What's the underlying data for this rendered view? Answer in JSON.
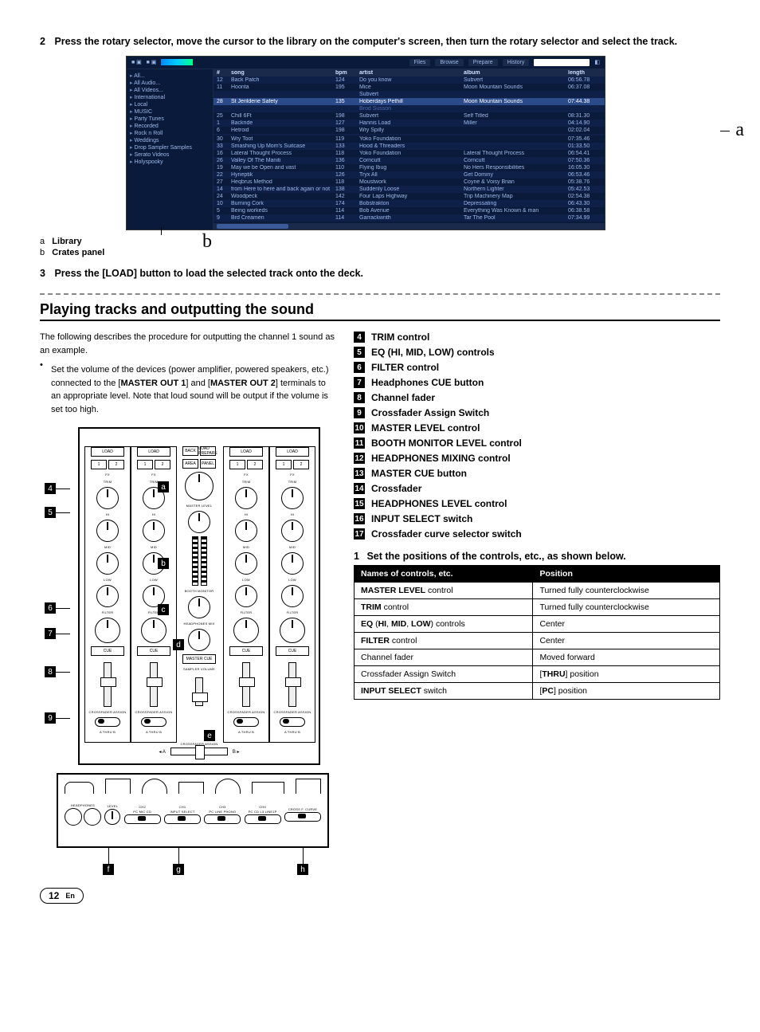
{
  "step2": {
    "num": "2",
    "text": "Press the rotary selector, move the cursor to the library on the computer's screen, then turn the rotary selector and select the track."
  },
  "shot": {
    "tabs": [
      "Files",
      "Browse",
      "Prepare",
      "History"
    ],
    "search_placeholder": "Q▾",
    "crates": [
      "All...",
      "All Audio...",
      "All Videos...",
      "International",
      "Local",
      "MUSIC",
      "Party Tunes",
      "Recorded",
      "Rock n Roll",
      "Weddings",
      "Drop Sampler Samples",
      "Serato Videos",
      "Holyspooky"
    ],
    "header": [
      "#",
      "song",
      "bpm",
      "artist",
      "album",
      "length"
    ],
    "rows": [
      {
        "n": "12",
        "song": "Back Patch",
        "bpm": "124",
        "artist": "Do you know",
        "album": "Subvert",
        "len": "06:56.78"
      },
      {
        "n": "11",
        "song": "Hoonta",
        "bpm": "195",
        "artist": "Mice",
        "album": "Moon Mountain Sounds",
        "len": "06:37.08"
      },
      {
        "n": "",
        "song": "",
        "bpm": "",
        "artist": "Subvert",
        "album": "",
        "len": ""
      },
      {
        "n": "28",
        "song": "St Jerilderie Safety",
        "bpm": "135",
        "artist": "Hoberdays Pethill",
        "album": "Moon Mountain Sounds",
        "len": "07:44.38",
        "hl": true
      },
      {
        "n": "",
        "song": "",
        "bpm": "",
        "artist": "Brod Susson",
        "album": "",
        "len": "",
        "dim": true
      },
      {
        "n": "25",
        "song": "Chill 6Ft",
        "bpm": "198",
        "artist": "Subvert",
        "album": "Self Titled",
        "len": "08:31.30"
      },
      {
        "n": "1",
        "song": "Backride",
        "bpm": "127",
        "artist": "Hannis Load",
        "album": "Miller",
        "len": "04:14.90"
      },
      {
        "n": "6",
        "song": "Hetroid",
        "bpm": "198",
        "artist": "Wry Spilly",
        "album": "",
        "len": "02:02.04"
      },
      {
        "n": "",
        "song": "",
        "bpm": "",
        "artist": "",
        "album": "",
        "len": "",
        "dim": true
      },
      {
        "n": "30",
        "song": "Wry Toot",
        "bpm": "119",
        "artist": "Yoko Foundation",
        "album": "",
        "len": "07:35.46"
      },
      {
        "n": "33",
        "song": "Smashing Up Mom's Suitcase",
        "bpm": "133",
        "artist": "Hood & Threaders",
        "album": "",
        "len": "01:33.50"
      },
      {
        "n": "16",
        "song": "Lateral Thought Process",
        "bpm": "118",
        "artist": "Yoko Foundation",
        "album": "Lateral Thought Process",
        "len": "06:54.41"
      },
      {
        "n": "26",
        "song": "Valley Of The Maniti",
        "bpm": "136",
        "artist": "Corncutt",
        "album": "Corncutt",
        "len": "07:50.36"
      },
      {
        "n": "19",
        "song": "May we be Open and vast",
        "bpm": "110",
        "artist": "Flying Ibug",
        "album": "No Hers Responsibilities",
        "len": "16:05.30"
      },
      {
        "n": "22",
        "song": "Hyneptik",
        "bpm": "126",
        "artist": "Tryx All",
        "album": "Get Dominy",
        "len": "06:53.46"
      },
      {
        "n": "27",
        "song": "Heqbrus Method",
        "bpm": "118",
        "artist": "Moustwork",
        "album": "Coyne & Voisy Brian",
        "len": "05:38.76"
      },
      {
        "n": "14",
        "song": "from Here to here and back again or not",
        "bpm": "138",
        "artist": "Suddenly Loose",
        "album": "Northern Lighter",
        "len": "05:42.53"
      },
      {
        "n": "24",
        "song": "Woodpeck",
        "bpm": "142",
        "artist": "Four Laps Highway",
        "album": "Trip Machinery Map",
        "len": "02:54.38"
      },
      {
        "n": "10",
        "song": "Burning Cork",
        "bpm": "174",
        "artist": "Bobstrakton",
        "album": "Depressating",
        "len": "06:43.30"
      },
      {
        "n": "5",
        "song": "Being workeds",
        "bpm": "114",
        "artist": "Bob Avenue",
        "album": "Everything Was Known & man",
        "len": "06:38.58"
      },
      {
        "n": "9",
        "song": "Brd Creamen",
        "bpm": "114",
        "artist": "Garrackwnth",
        "album": "Tar The Pool",
        "len": "07:34.99"
      }
    ]
  },
  "label_a": "a",
  "label_b": "b",
  "ab": {
    "a_key": "a",
    "a_val": "Library",
    "b_key": "b",
    "b_val": "Crates panel"
  },
  "step3": {
    "num": "3",
    "text": "Press the [LOAD] button to load the selected track onto the deck."
  },
  "section_title": "Playing tracks and outputting the sound",
  "intro": "The following describes the procedure for outputting the channel 1 sound as an example.",
  "bullet": "Set the volume of the devices (power amplifier, powered speakers, etc.) connected to the [MASTER OUT 1] and [MASTER OUT 2] terminals to an appropriate level. Note that loud sound will be output if the volume is set too high.",
  "bullet_bold1": "MASTER OUT 1",
  "bullet_bold2": "MASTER OUT 2",
  "mixer_labels": {
    "load": "LOAD",
    "fx": "FX",
    "trim": "TRIM",
    "hi": "HI",
    "mid": "MID",
    "low": "LOW",
    "filter": "FILTER",
    "cue": "CUE",
    "master_level": "MASTER LEVEL",
    "booth": "BOOTH MONITOR",
    "hp_mix": "HEADPHONES MIX",
    "master_cue": "MASTER CUE",
    "sampler_vol": "SAMPLER VOLUME",
    "crossfader": "CROSSFADER",
    "cf_assign": "CROSSFADER ASSIGN",
    "a": "A",
    "b": "B",
    "thru": "THRU",
    "back": "BACK",
    "load_prep": "LOAD PREPARE",
    "panel": "PANEL",
    "area": "AREA",
    "pc_mic_cd": "PC MIC CD",
    "line_phono": "LINE PHONO"
  },
  "front_labels": {
    "headphones": "HEADPHONES",
    "level": "LEVEL",
    "ch2": "CH2",
    "ch1": "CH1",
    "ch3": "CH3",
    "ch4": "CH4",
    "pc_mic_cd": "PC MIC CD",
    "input_select": "INPUT SELECT",
    "pc_line": "PC LINE PHONO",
    "pc_cd_13": "PC CD L3 LINE1P",
    "cf_curve": "CROSS F. CURVE"
  },
  "legend": [
    {
      "n": "4",
      "t": "TRIM control"
    },
    {
      "n": "5",
      "t": "EQ (HI, MID, LOW) controls"
    },
    {
      "n": "6",
      "t": "FILTER control"
    },
    {
      "n": "7",
      "t": "Headphones CUE button"
    },
    {
      "n": "8",
      "t": "Channel fader"
    },
    {
      "n": "9",
      "t": "Crossfader Assign Switch"
    },
    {
      "n": "10",
      "t": "MASTER LEVEL control"
    },
    {
      "n": "11",
      "t": "BOOTH MONITOR LEVEL control"
    },
    {
      "n": "12",
      "t": "HEADPHONES MIXING control"
    },
    {
      "n": "13",
      "t": "MASTER CUE button"
    },
    {
      "n": "14",
      "t": "Crossfader"
    },
    {
      "n": "15",
      "t": "HEADPHONES LEVEL control"
    },
    {
      "n": "16",
      "t": "INPUT SELECT switch"
    },
    {
      "n": "17",
      "t": "Crossfader curve selector switch"
    }
  ],
  "step_pos": {
    "n": "1",
    "t": "Set the positions of the controls, etc., as shown below."
  },
  "pos_table": {
    "h1": "Names of controls, etc.",
    "h2": "Position",
    "rows": [
      {
        "name": "MASTER LEVEL control",
        "bold": "MASTER LEVEL",
        "rest": " control",
        "pos": "Turned fully counterclockwise"
      },
      {
        "name": "TRIM control",
        "bold": "TRIM",
        "rest": " control",
        "pos": "Turned fully counterclockwise"
      },
      {
        "name": "EQ (HI, MID, LOW) controls",
        "bold": "EQ",
        "rest": " (HI, MID, LOW) controls",
        "pos": "Center",
        "bold2a": "HI",
        "bold2b": "MID",
        "bold2c": "LOW"
      },
      {
        "name": "FILTER control",
        "bold": "FILTER",
        "rest": " control",
        "pos": "Center"
      },
      {
        "name": "Channel fader",
        "bold": "",
        "rest": "Channel fader",
        "pos": "Moved forward"
      },
      {
        "name": "Crossfader Assign Switch",
        "bold": "",
        "rest": "Crossfader Assign Switch",
        "pos": "[THRU] position",
        "posbold": "THRU"
      },
      {
        "name": "INPUT SELECT switch",
        "bold": "INPUT SELECT",
        "rest": " switch",
        "pos": "[PC] position",
        "posbold": "PC"
      }
    ]
  },
  "page": {
    "num": "12",
    "lang": "En"
  }
}
